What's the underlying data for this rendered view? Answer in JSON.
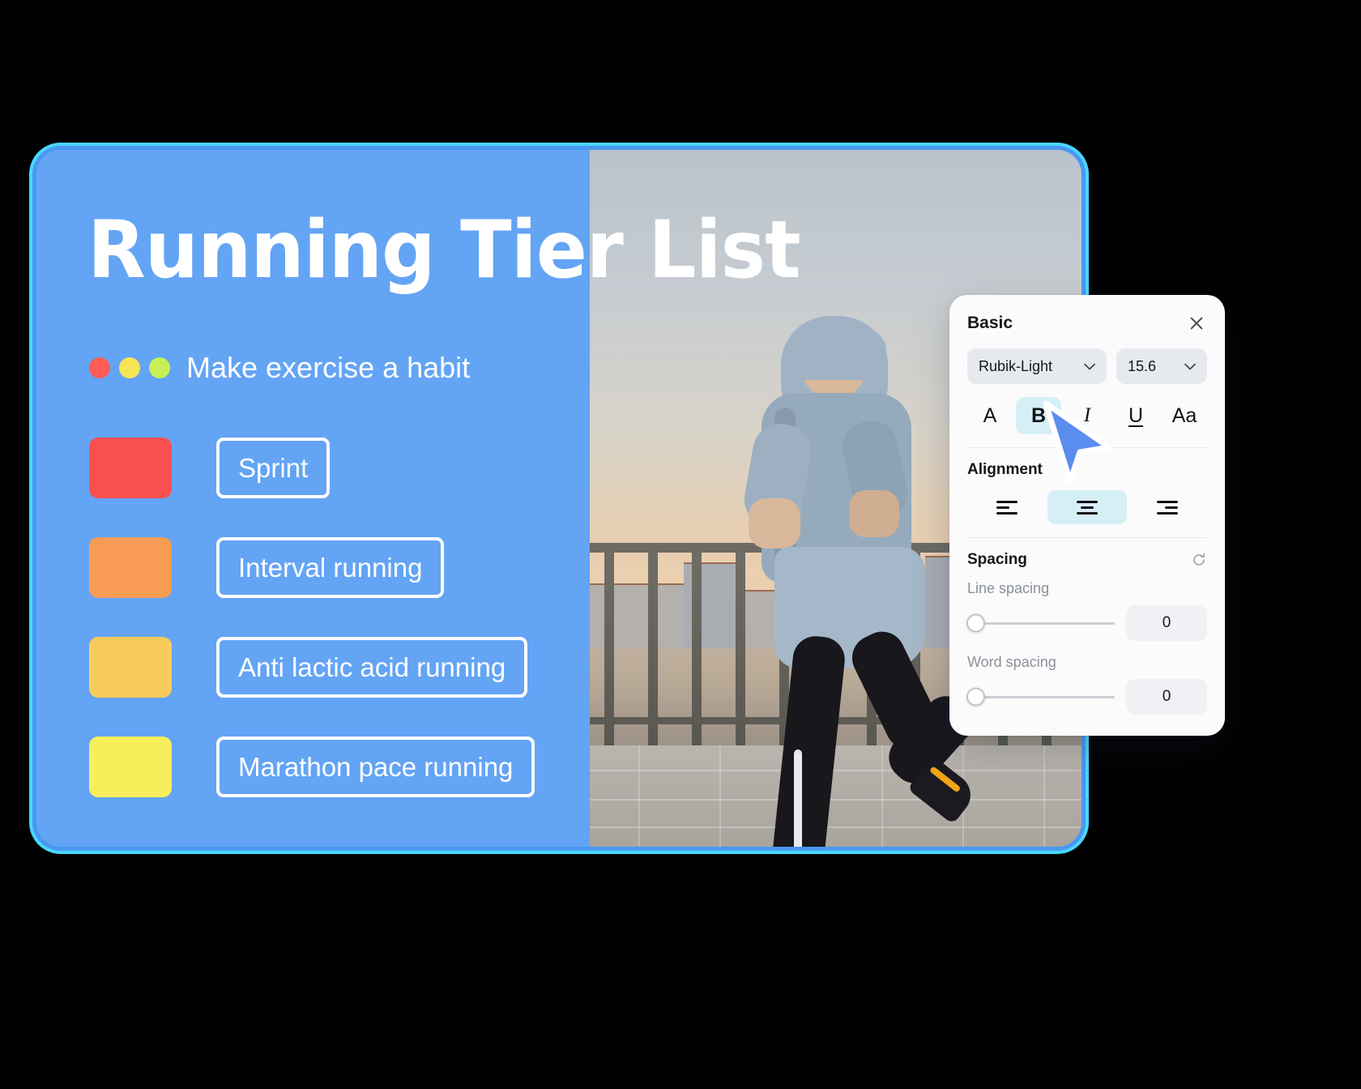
{
  "slide": {
    "title": "Running Tier List",
    "subtitle": "Make exercise a habit",
    "dots": [
      {
        "name": "red",
        "color": "#FF5B57"
      },
      {
        "name": "yellow",
        "color": "#F7E455"
      },
      {
        "name": "lime",
        "color": "#C6F055"
      }
    ],
    "tiers": [
      {
        "swatch_color": "#F9504F",
        "label": "Sprint"
      },
      {
        "swatch_color": "#F89B55",
        "label": "Interval running"
      },
      {
        "swatch_color": "#F9CB5C",
        "label": "Anti lactic acid running"
      },
      {
        "swatch_color": "#F7EE5C",
        "label": "Marathon pace running"
      }
    ],
    "background_color": "#63A4F4",
    "border_color": "#47D8FF",
    "photo_alt": "Man in grey hoodie running along a waterfront railing at dusk"
  },
  "format_panel": {
    "title": "Basic",
    "close_icon": "close-icon",
    "font_family": {
      "value": "Rubik-Light",
      "chevron_icon": "chevron-down-icon"
    },
    "font_size": {
      "value": "15.6",
      "chevron_icon": "chevron-down-icon"
    },
    "style_buttons": [
      {
        "icon": "font-color-icon",
        "glyph": "A",
        "active": false
      },
      {
        "icon": "bold-icon",
        "glyph": "B",
        "active": true
      },
      {
        "icon": "italic-icon",
        "glyph": "I",
        "active": false
      },
      {
        "icon": "underline-icon",
        "glyph": "U",
        "active": false
      },
      {
        "icon": "text-case-icon",
        "glyph": "Aa",
        "active": false
      }
    ],
    "alignment": {
      "label": "Alignment",
      "options": [
        {
          "icon": "align-left-icon",
          "active": false
        },
        {
          "icon": "align-center-icon",
          "active": true
        },
        {
          "icon": "align-right-icon",
          "active": false
        }
      ]
    },
    "spacing": {
      "label": "Spacing",
      "reset_icon": "reset-icon",
      "line_spacing": {
        "label": "Line spacing",
        "value": "0"
      },
      "word_spacing": {
        "label": "Word spacing",
        "value": "0"
      }
    },
    "active_highlight_color": "#D6EFF6"
  },
  "cursor": {
    "icon": "mouse-pointer-icon",
    "color": "#5B8DEF"
  }
}
